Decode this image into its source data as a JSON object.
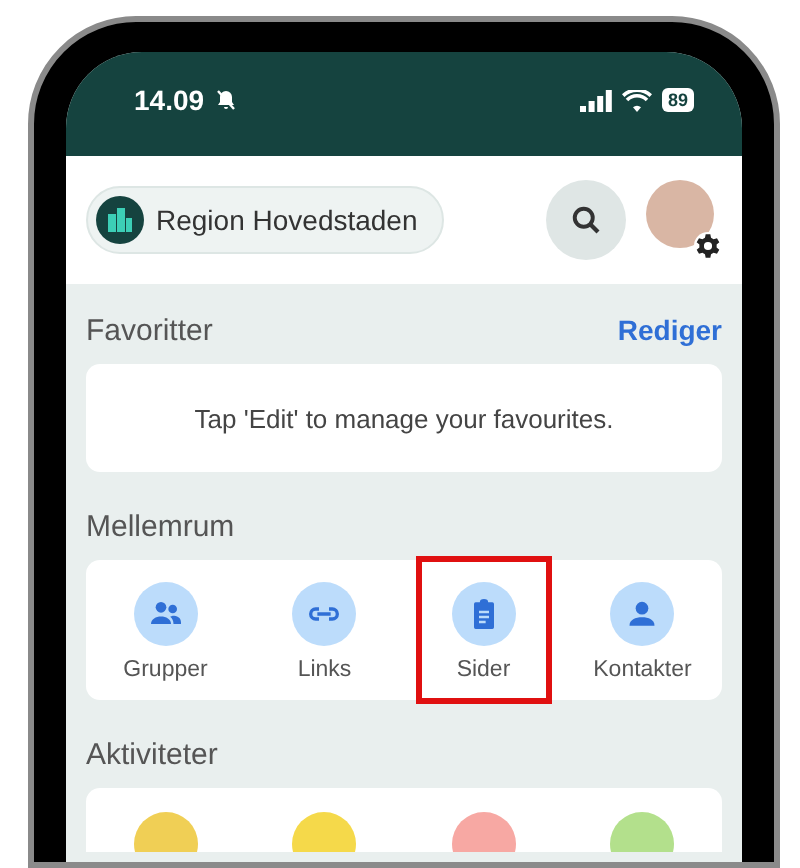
{
  "status_bar": {
    "time": "14.09",
    "battery": "89"
  },
  "top_bar": {
    "organization": "Region Hovedstaden"
  },
  "favorites": {
    "title": "Favoritter",
    "action": "Rediger",
    "empty_message": "Tap 'Edit' to manage your favourites."
  },
  "spaces": {
    "title": "Mellemrum",
    "items": [
      {
        "label": "Grupper",
        "kind": "groups",
        "highlighted": false
      },
      {
        "label": "Links",
        "kind": "link",
        "highlighted": false
      },
      {
        "label": "Sider",
        "kind": "page",
        "highlighted": true
      },
      {
        "label": "Kontakter",
        "kind": "person",
        "highlighted": false
      }
    ]
  },
  "activities": {
    "title": "Aktiviteter",
    "items": [
      {
        "color": "#f0cf55"
      },
      {
        "color": "#f5d94a"
      },
      {
        "color": "#f7a8a3"
      },
      {
        "color": "#b3e08c"
      }
    ]
  }
}
